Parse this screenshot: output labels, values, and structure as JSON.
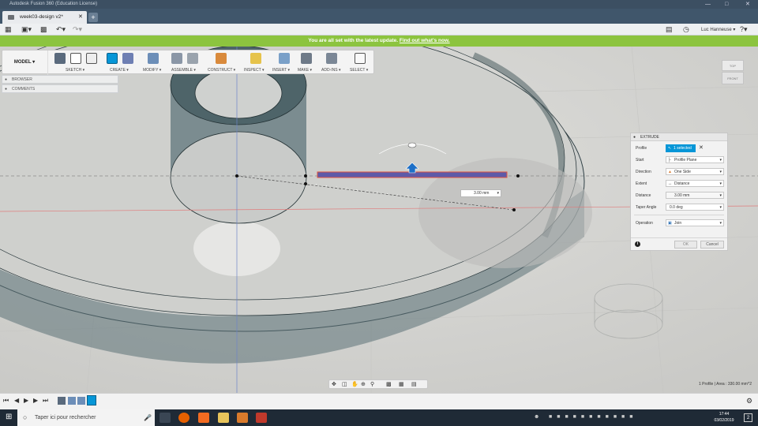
{
  "window": {
    "title": "Autodesk Fusion 360 (Education License)"
  },
  "tab": {
    "title": "week03-design v2*"
  },
  "user": {
    "name": "Luc Hanneuse ▾"
  },
  "banner": {
    "text": "You are all set with the latest update.",
    "link": "Find out what's now."
  },
  "toolbar": {
    "workspace": "MODEL ▾",
    "groups": [
      "SKETCH ▾",
      "CREATE ▾",
      "MODIFY ▾",
      "ASSEMBLE ▾",
      "CONSTRUCT ▾",
      "INSPECT ▾",
      "INSERT ▾",
      "MAKE ▾",
      "ADD-INS ▾",
      "SELECT ▾"
    ]
  },
  "panels": {
    "browser": "BROWSER",
    "comments": "COMMENTS"
  },
  "viewcube": {
    "top": "TOP",
    "front": "FRONT"
  },
  "manipulator": {
    "value": "3.00 mm"
  },
  "extrude": {
    "title": "EXTRUDE",
    "rows": [
      {
        "label": "Profile",
        "value": "1 selected"
      },
      {
        "label": "Start",
        "value": "Profile Plane"
      },
      {
        "label": "Direction",
        "value": "One Side"
      },
      {
        "label": "Extent",
        "value": "Distance"
      },
      {
        "label": "Distance",
        "value": "3.00 mm"
      },
      {
        "label": "Taper Angle",
        "value": "0.0 deg"
      },
      {
        "label": "Operation",
        "value": "Join"
      }
    ],
    "ok": "OK",
    "cancel": "Cancel",
    "info": "i"
  },
  "status": {
    "text": "1 Profile | Area : 330.00 mm^2"
  },
  "taskbar": {
    "search_placeholder": "Taper ici pour rechercher",
    "time": "17:44",
    "date": "03/02/2019",
    "notif": "2"
  },
  "colors": {
    "accent": "#0696d7",
    "banner": "#8cc43f",
    "titlebar": "#3c4f62",
    "taskbar": "#1f2a36"
  }
}
